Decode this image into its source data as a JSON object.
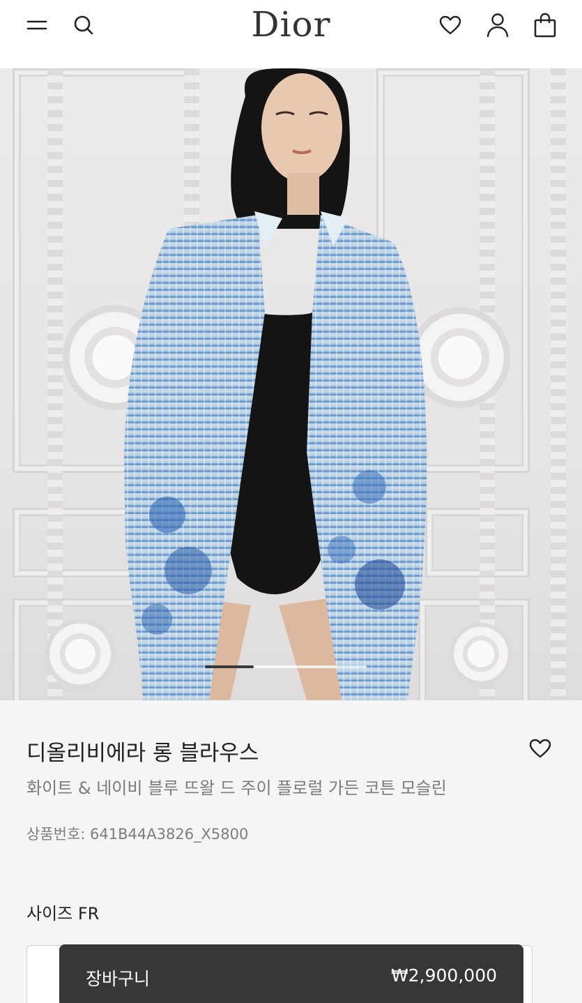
{
  "header": {
    "brand": "Dior",
    "menu_icon": "hamburger-menu-icon",
    "search_icon": "search-icon",
    "wishlist_icon": "heart-icon",
    "account_icon": "user-icon",
    "bag_icon": "shopping-bag-icon"
  },
  "gallery": {
    "image_description_icon": "product-photo",
    "progress_fraction": 0.3
  },
  "product": {
    "name": "디올리비에라 롱 블라우스",
    "description": "화이트 & 네이비 블루 뜨왈 드 주이 플로럴 가든 코튼 모슬린",
    "sku": "상품번호: 641B44A3826_X5800",
    "wishlist_icon": "heart-icon"
  },
  "size": {
    "label": "사이즈 FR"
  },
  "cart": {
    "label": "장바구니",
    "price": "₩2,900,000"
  },
  "colors": {
    "cart_bar": "#353738",
    "background": "#f5f5f5"
  }
}
